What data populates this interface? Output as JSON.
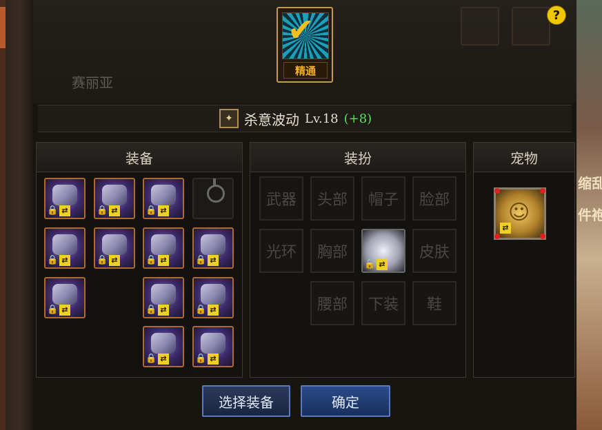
{
  "background": {
    "left_npc_name": "赛丽亚",
    "right_text_1": "缩乱",
    "right_text_2": "件袍"
  },
  "help": {
    "label": "?"
  },
  "skill": {
    "badge": "精通",
    "name": "杀意波动",
    "level": "Lv.18",
    "bonus": "(+8)"
  },
  "panels": {
    "equipment": {
      "title": "装备",
      "slot_count_filled": 12,
      "slot_count_empty": 1
    },
    "costume": {
      "title": "装扮",
      "slots": [
        "武器",
        "头部",
        "帽子",
        "脸部",
        "光环",
        "胸部",
        "",
        "皮肤",
        "腰部",
        "下装",
        "鞋"
      ],
      "filled_slot": "上衣"
    },
    "pet": {
      "title": "宠物"
    }
  },
  "buttons": {
    "select_equipment": "选择装备",
    "confirm": "确定"
  },
  "colors": {
    "accent_gold": "#c89a4a",
    "bonus_green": "#5ae05a",
    "slot_border": "#b06a2a",
    "button_border": "#5a7ac0"
  }
}
